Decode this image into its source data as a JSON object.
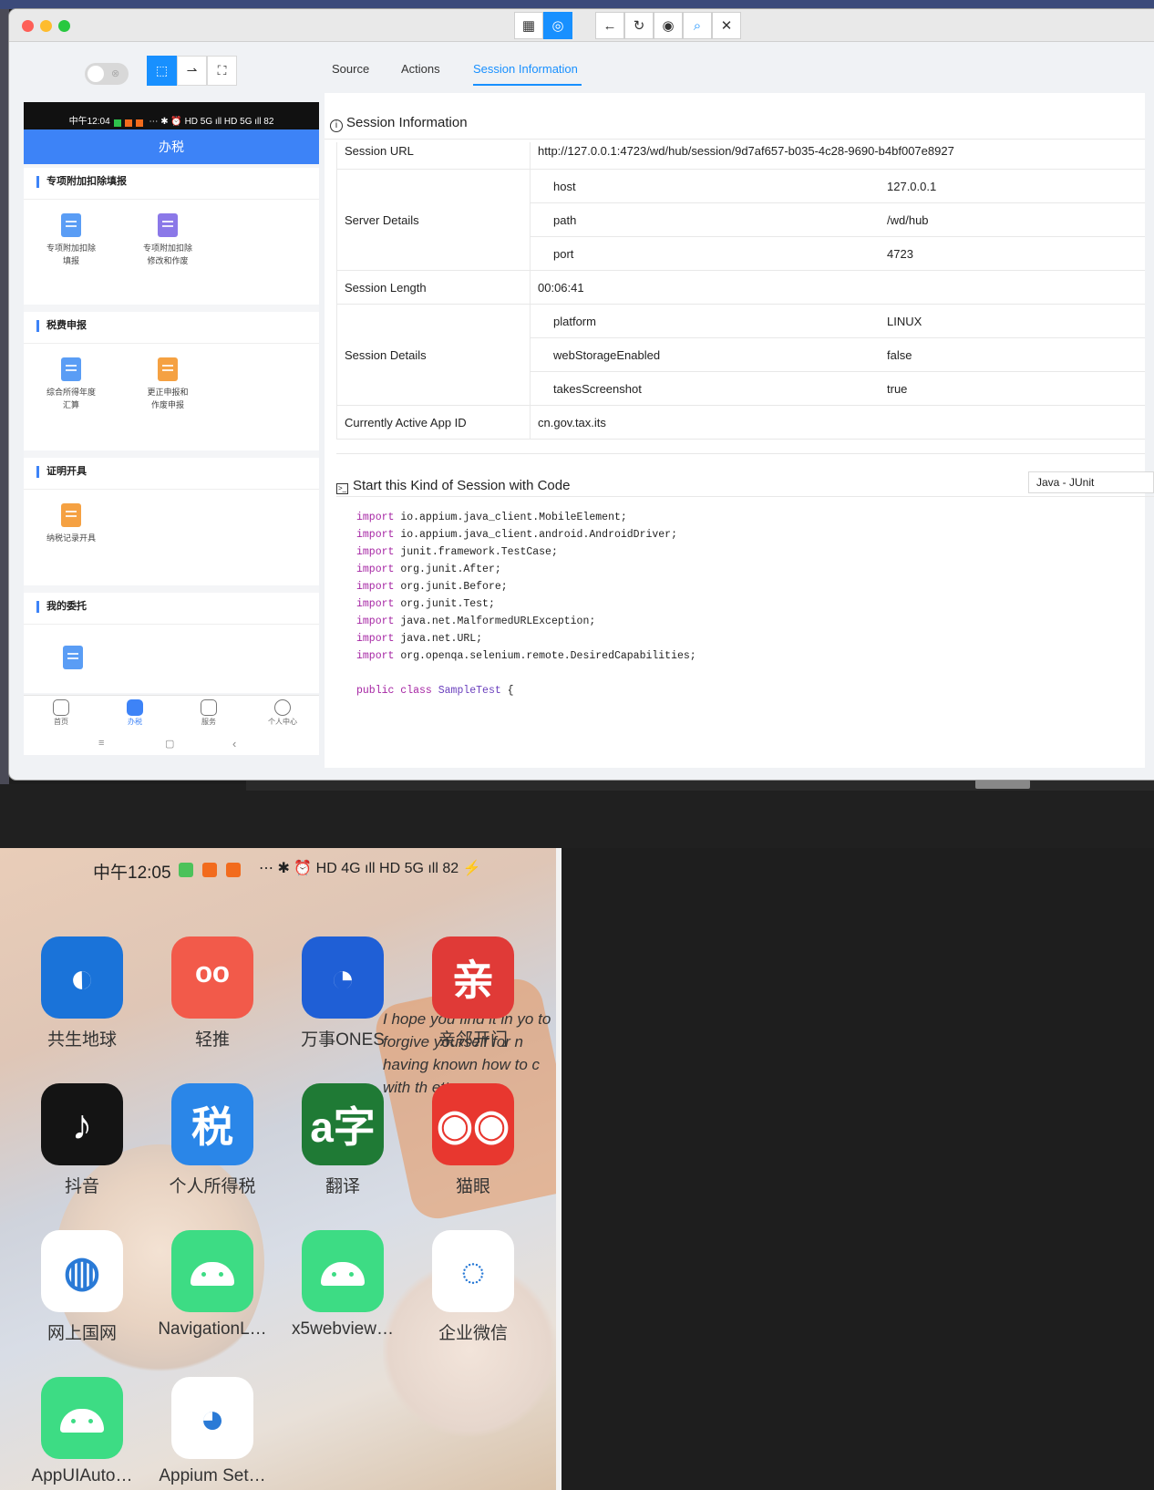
{
  "colors": {
    "accent": "#1890ff",
    "phone_blue": "#3d83f7"
  },
  "window": {
    "toolbar_icons": [
      "grid-icon",
      "globe-icon",
      "back-icon",
      "refresh-icon",
      "eye-icon",
      "search-icon",
      "close-icon"
    ],
    "tabs": [
      "Source",
      "Actions",
      "Session Information"
    ],
    "active_tab": "Session Information"
  },
  "phone": {
    "status_time": "中午12:04",
    "status_icons": "⋯   ✱ ⏰ HD 5G ıll HD 5G ıll 82",
    "header": "办税",
    "sections": [
      {
        "title": "专项附加扣除填报",
        "items": [
          {
            "line1": "专项附加扣除",
            "line2": "填报"
          },
          {
            "line1": "专项附加扣除",
            "line2": "修改和作废"
          }
        ]
      },
      {
        "title": "税费申报",
        "items": [
          {
            "line1": "综合所得年度",
            "line2": "汇算"
          },
          {
            "line1": "更正申报和",
            "line2": "作废申报"
          }
        ]
      },
      {
        "title": "证明开具",
        "items": [
          {
            "line1": "纳税记录开具",
            "line2": ""
          }
        ]
      },
      {
        "title": "我的委托",
        "items": []
      }
    ],
    "nav": [
      "首页",
      "办税",
      "服务",
      "个人中心"
    ],
    "sys_nav": [
      "≡",
      "▢",
      "‹"
    ]
  },
  "session": {
    "title": "Session Information",
    "url_label": "Session URL",
    "url_value": "http://127.0.0.1:4723/wd/hub/session/9d7af657-b035-4c28-9690-b4bf007e8927",
    "server_label": "Server Details",
    "server": [
      {
        "k": "host",
        "v": "127.0.0.1"
      },
      {
        "k": "path",
        "v": "/wd/hub"
      },
      {
        "k": "port",
        "v": "4723"
      }
    ],
    "length_label": "Session Length",
    "length_value": "00:06:41",
    "details_label": "Session Details",
    "details": [
      {
        "k": "platform",
        "v": "LINUX"
      },
      {
        "k": "webStorageEnabled",
        "v": "false"
      },
      {
        "k": "takesScreenshot",
        "v": "true"
      }
    ],
    "app_label": "Currently Active App ID",
    "app_value": "cn.gov.tax.its"
  },
  "code": {
    "title": "Start this Kind of Session with Code",
    "language": "Java - JUnit",
    "imports": [
      "io.appium.java_client.MobileElement;",
      "io.appium.java_client.android.AndroidDriver;",
      "junit.framework.TestCase;",
      "org.junit.After;",
      "org.junit.Before;",
      "org.junit.Test;",
      "java.net.MalformedURLException;",
      "java.net.URL;",
      "org.openqa.selenium.remote.DesiredCapabilities;"
    ],
    "import_kw": "import",
    "class_decl_kw": "public class",
    "class_name": "SampleTest",
    "brace": "{"
  },
  "home": {
    "status_time": "中午12:05",
    "status_icons": "⋯    ✱ ⏰ HD 4G ıll HD 5G ıll 82 ⚡",
    "quote": "I hope you find it in yo to forgive yourself for n having known how to c with th     etter.",
    "apps": [
      {
        "label": "共生地球",
        "icon": "globe-icon",
        "color": "#1a73d9",
        "glyph": "◐"
      },
      {
        "label": "轻推",
        "icon": "tuitui-icon",
        "color": "#f25a4a",
        "glyph": "ᵒᵒ"
      },
      {
        "label": "万事ONES",
        "icon": "ones-icon",
        "color": "#1f5fd6",
        "glyph": "◔"
      },
      {
        "label": "亲邻开门",
        "icon": "qin-icon",
        "color": "#e03a37",
        "glyph": "亲"
      },
      {
        "label": "抖音",
        "icon": "douyin-icon",
        "color": "#141414",
        "glyph": "♪"
      },
      {
        "label": "个人所得税",
        "icon": "tax-shield-icon",
        "color": "#2a86e8",
        "glyph": "税"
      },
      {
        "label": "翻译",
        "icon": "translate-icon",
        "color": "#1f7a35",
        "glyph": "a字"
      },
      {
        "label": "猫眼",
        "icon": "maoyan-icon",
        "color": "#e8372f",
        "glyph": "◉◉"
      },
      {
        "label": "网上国网",
        "icon": "state-grid-icon",
        "color": "#ffffff",
        "glyph": "◍"
      },
      {
        "label": "NavigationL…",
        "icon": "android-icon",
        "color": "#3ddc84",
        "glyph": ""
      },
      {
        "label": "x5webview…",
        "icon": "android-icon",
        "color": "#3ddc84",
        "glyph": ""
      },
      {
        "label": "企业微信",
        "icon": "wecom-icon",
        "color": "#ffffff",
        "glyph": "◌"
      },
      {
        "label": "AppUIAuto…",
        "icon": "android-icon",
        "color": "#3ddc84",
        "glyph": ""
      },
      {
        "label": "Appium Set…",
        "icon": "appium-icon",
        "color": "#ffffff",
        "glyph": "◕"
      }
    ]
  }
}
